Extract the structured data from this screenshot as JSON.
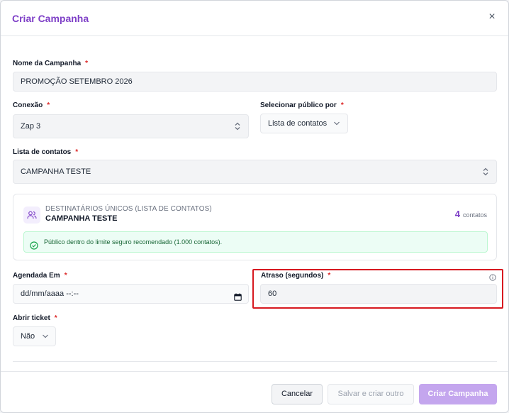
{
  "dialog": {
    "title": "Criar Campanha",
    "close_glyph": "×"
  },
  "form": {
    "campaign_name": {
      "label": "Nome da Campanha",
      "required": "*",
      "value": "PROMOÇÃO SETEMBRO 2026"
    },
    "connection": {
      "label": "Conexão",
      "required": "*",
      "value": "Zap 3"
    },
    "audience": {
      "label": "Selecionar público por",
      "required": "*",
      "value": "Lista de contatos"
    },
    "contact_list": {
      "label": "Lista de contatos",
      "required": "*",
      "value": "CAMPANHA TESTE"
    },
    "summary": {
      "caption": "DESTINATÁRIOS ÚNICOS (LISTA DE CONTATOS)",
      "list_name": "CAMPANHA TESTE",
      "count": "4",
      "count_unit": "contatos",
      "alert": "Público dentro do limite seguro recomendado (1.000 contatos)."
    },
    "scheduled_at": {
      "label": "Agendada Em",
      "required": "*",
      "value": "dd/mm/aaaa --:--"
    },
    "delay": {
      "label": "Atraso (segundos)",
      "required": "*",
      "value": "60"
    },
    "open_ticket": {
      "label": "Abrir ticket",
      "required": "*",
      "value": "Não"
    }
  },
  "footer": {
    "cancel": "Cancelar",
    "save_and_new": "Salvar e criar outro",
    "create": "Criar Campanha"
  },
  "colors": {
    "accent": "#7e3fc7",
    "highlight": "#d71920",
    "success": "#166534"
  }
}
